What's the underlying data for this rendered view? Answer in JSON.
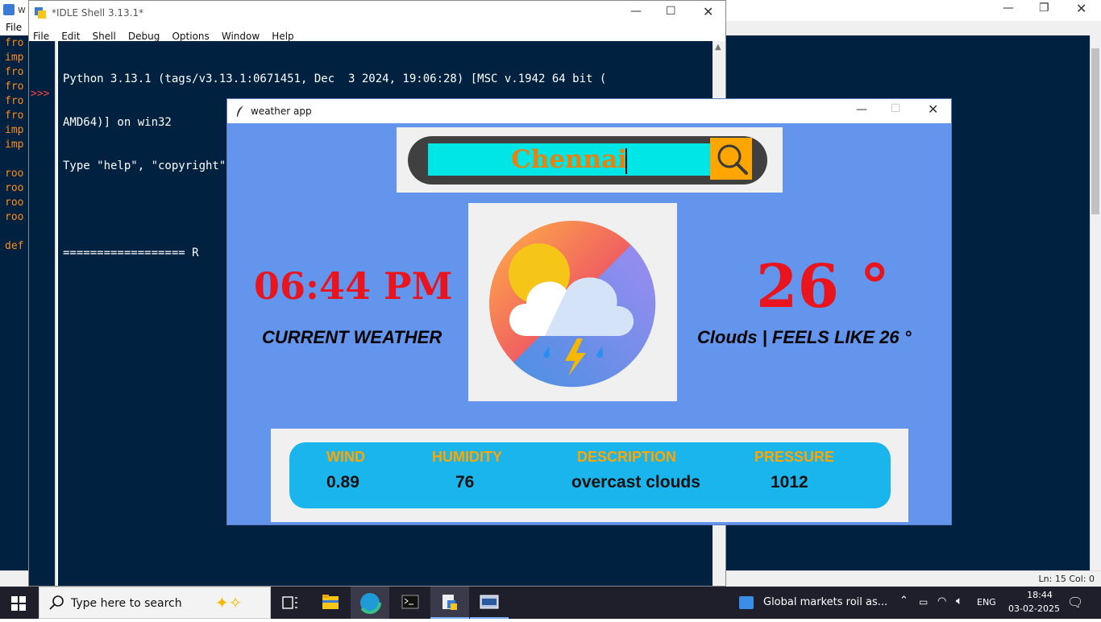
{
  "background_window": {
    "title": "w",
    "menu_file": "File",
    "code_fragments": [
      "fro",
      "imp",
      "fro",
      "fro",
      "fro",
      "fro",
      "imp",
      "imp",
      "",
      "roo",
      "roo",
      "roo",
      "roo",
      "",
      "def"
    ],
    "status": "Ln: 15   Col: 0"
  },
  "idle": {
    "title": "*IDLE Shell 3.13.1*",
    "menu": [
      "File",
      "Edit",
      "Shell",
      "Debug",
      "Options",
      "Window",
      "Help"
    ],
    "prompt": ">>>",
    "lines": [
      "Python 3.13.1 (tags/v3.13.1:0671451, Dec  3 2024, 19:06:28) [MSC v.1942 64 bit (",
      "AMD64)] on win32",
      "Type \"help\", \"copyright\", \"credits\" or \"license()\" for more information.",
      "",
      "================== R"
    ]
  },
  "weather_app": {
    "title": "weather app",
    "city": "Chennai",
    "time": "06:44 PM",
    "current_label": "CURRENT WEATHER",
    "temperature": "26 °",
    "feels": "Clouds | FEELS LIKE 26 °",
    "stats": {
      "wind_label": "WIND",
      "wind_value": "0.89",
      "humidity_label": "HUMIDITY",
      "humidity_value": "76",
      "description_label": "DESCRIPTION",
      "description_value": "overcast clouds",
      "pressure_label": "PRESSURE",
      "pressure_value": "1012"
    }
  },
  "taskbar": {
    "search_placeholder": "Type here to search",
    "news": "Global markets roil as...",
    "lang": "ENG",
    "time": "18:44",
    "date": "03-02-2025"
  },
  "colors": {
    "app_bg": "#6495ed",
    "accent_orange": "#ffa500",
    "temp_red": "#e8141e",
    "search_cyan": "#00e5e5",
    "stats_blue": "#1ab5ec"
  }
}
